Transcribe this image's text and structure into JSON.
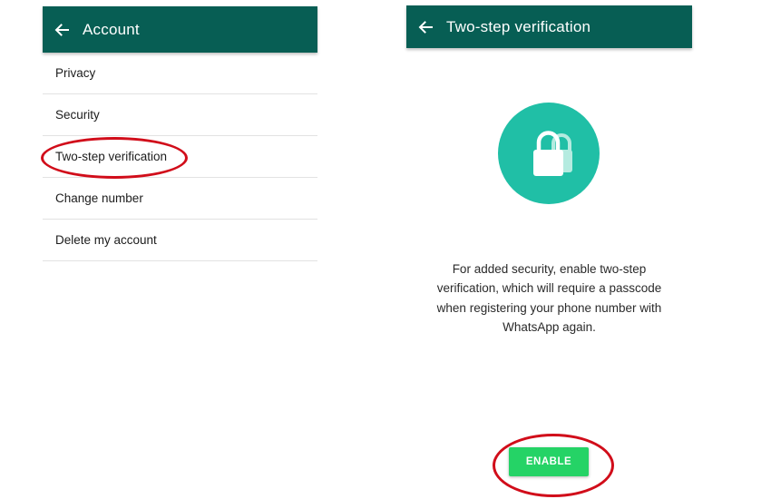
{
  "account_screen": {
    "title": "Account",
    "back_icon": "arrow-left-icon",
    "items": [
      {
        "label": "Privacy"
      },
      {
        "label": "Security"
      },
      {
        "label": "Two-step verification"
      },
      {
        "label": "Change number"
      },
      {
        "label": "Delete my account"
      }
    ]
  },
  "two_step_screen": {
    "title": "Two-step verification",
    "back_icon": "arrow-left-icon",
    "lock_icon": "lock-icon",
    "description": "For added security, enable two-step verification, which will require a passcode when registering your phone number with WhatsApp again.",
    "enable_label": "ENABLE"
  },
  "colors": {
    "appbar": "#075e54",
    "accent_teal": "#20bfa6",
    "button_green": "#25d366",
    "highlight_red": "#d10d1a"
  }
}
